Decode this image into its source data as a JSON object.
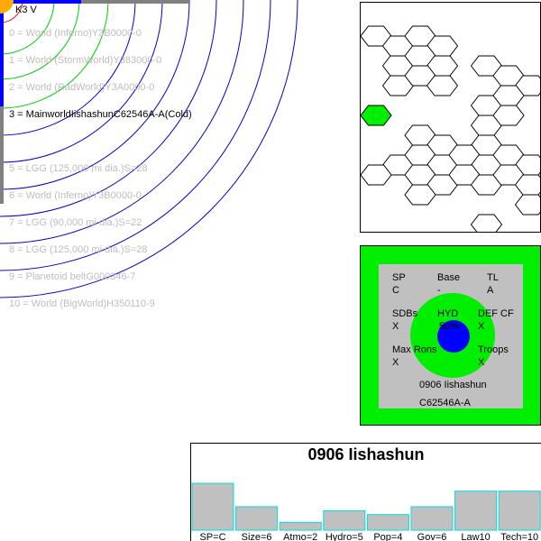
{
  "system": {
    "star": "K3 V",
    "orbits": [
      {
        "label": "0 = World  (Inferno)Y3B0000-0",
        "main": false
      },
      {
        "label": "1 = World  (StormWorld)Y383000-0",
        "main": false
      },
      {
        "label": "2 = World  (RadWorld)Y3A0000-0",
        "main": false
      },
      {
        "label": "3 = MainworldIishashunC62546A-A(Cold)",
        "main": true
      },
      {
        "label": "5 = LGG (125,000 mi dia.)S=28",
        "main": false
      },
      {
        "label": "6 = World  (Inferno)Y3B0000-0",
        "main": false
      },
      {
        "label": "7 = LGG (90,000 mi dia.)S=22",
        "main": false
      },
      {
        "label": "8 = LGG (125,000 mi dia.)S=28",
        "main": false
      },
      {
        "label": "9 = Planetoid beltG000346-7",
        "main": false
      },
      {
        "label": "10 = World  (BigWorld)H350110-9",
        "main": false
      }
    ]
  },
  "hexmap": {
    "hexes": [
      {
        "col": 0,
        "row": 0
      },
      {
        "col": 1,
        "row": 0
      },
      {
        "col": 2,
        "row": 0
      },
      {
        "col": 3,
        "row": 0
      },
      {
        "col": 1,
        "row": 1
      },
      {
        "col": 2,
        "row": 1
      },
      {
        "col": 3,
        "row": 1
      },
      {
        "col": 5,
        "row": 1
      },
      {
        "col": 1,
        "row": 2
      },
      {
        "col": 2,
        "row": 2
      },
      {
        "col": 3,
        "row": 2
      },
      {
        "col": 6,
        "row": 2
      },
      {
        "col": 7,
        "row": 2
      },
      {
        "col": 5,
        "row": 3
      },
      {
        "col": 6,
        "row": 3
      },
      {
        "col": 0,
        "row": 4,
        "green": true
      },
      {
        "col": 5,
        "row": 4
      },
      {
        "col": 6,
        "row": 4
      },
      {
        "col": 2,
        "row": 5
      },
      {
        "col": 3,
        "row": 5
      },
      {
        "col": 5,
        "row": 5
      },
      {
        "col": 1,
        "row": 6
      },
      {
        "col": 2,
        "row": 6
      },
      {
        "col": 3,
        "row": 6
      },
      {
        "col": 4,
        "row": 6
      },
      {
        "col": 5,
        "row": 6
      },
      {
        "col": 6,
        "row": 6
      },
      {
        "col": 7,
        "row": 6
      },
      {
        "col": 0,
        "row": 7
      },
      {
        "col": 2,
        "row": 7
      },
      {
        "col": 3,
        "row": 7
      },
      {
        "col": 4,
        "row": 7
      },
      {
        "col": 5,
        "row": 7
      },
      {
        "col": 6,
        "row": 7
      },
      {
        "col": 7,
        "row": 7
      },
      {
        "col": 2,
        "row": 8
      },
      {
        "col": 7,
        "row": 8
      },
      {
        "col": 5,
        "row": 9
      }
    ],
    "colors": {
      "hex_stroke": "#000000",
      "mainworld": "#00ee00"
    }
  },
  "uwp": {
    "sp_label": "SP",
    "sp_value": "C",
    "base_label": "Base",
    "base_value": "-",
    "tl_label": "TL",
    "tl_value": "A",
    "sdbs_label": "SDBs",
    "sdbs_value": "X",
    "hyd_label": "HYD",
    "hyd_value": "50%",
    "def_label": "DEF CF",
    "def_value": "X",
    "maxrons_label": "Max Rons",
    "maxrons_value": "X",
    "troops_label": "Troops",
    "troops_value": "X",
    "world_hex_name": "0906 Iishashun",
    "uwp_code": "C62546A-A",
    "colors": {
      "panel": "#00ee00",
      "inner": "#c0c0c0",
      "water": "#0000ff"
    }
  },
  "summary": {
    "title": "0906 Iishashun",
    "chart_data": {
      "type": "bar",
      "categories": [
        "SP=C",
        "Size=6",
        "Atmo=2",
        "Hydro=5",
        "Pop=4",
        "Gov=6",
        "Law10",
        "Tech=10"
      ],
      "values": [
        12,
        6,
        2,
        5,
        4,
        6,
        10,
        10
      ],
      "ylim": [
        0,
        12
      ],
      "colors": {
        "fill": "#c0c0c0",
        "stroke": "#00dddd"
      }
    }
  }
}
